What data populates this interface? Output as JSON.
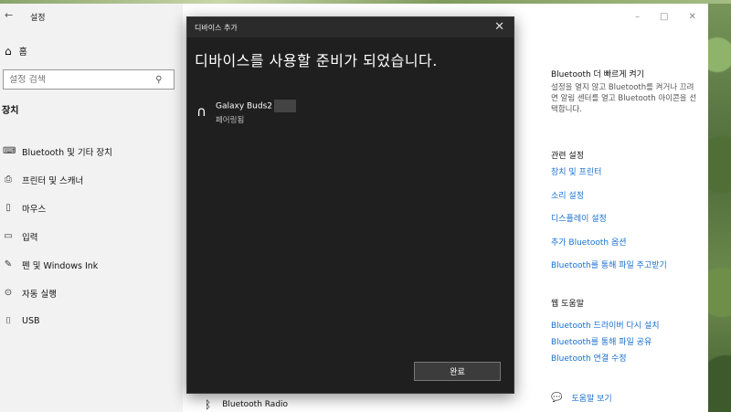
{
  "settings": {
    "title": "설정",
    "back_icon": "back-arrow-icon",
    "home_label": "홈",
    "search_placeholder": "설정 검색",
    "section_title": "장치",
    "nav": [
      {
        "label": "Bluetooth 및 기타 장치",
        "icon": "bluetooth-devices-icon"
      },
      {
        "label": "프린터 및 스캐너",
        "icon": "printer-icon"
      },
      {
        "label": "마우스",
        "icon": "mouse-icon"
      },
      {
        "label": "입력",
        "icon": "keyboard-icon"
      },
      {
        "label": "펜 및 Windows Ink",
        "icon": "pen-icon"
      },
      {
        "label": "자동 실행",
        "icon": "autoplay-icon"
      },
      {
        "label": "USB",
        "icon": "usb-icon"
      }
    ],
    "bluetooth_radio": "Bluetooth Radio"
  },
  "right_panel": {
    "quick_heading": "Bluetooth 더 빠르게 켜기",
    "quick_desc": "설정을 열지 않고 Bluetooth를 켜거나 끄려면 알림 센터를 열고 Bluetooth 아이콘을 선택합니다.",
    "related_heading": "관련 설정",
    "related_links": [
      "장치 및 프린터",
      "소리 설정",
      "디스플레이 설정",
      "추가 Bluetooth 옵션",
      "Bluetooth를 통해 파일 주고받기"
    ],
    "help_heading": "웹 도움말",
    "help_links": [
      "Bluetooth 드라이버 다시 설치",
      "Bluetooth를 통해 파일 공유",
      "Bluetooth 연결 수정"
    ],
    "get_help": "도움말 보기"
  },
  "dialog": {
    "title": "디바이스 추가",
    "heading": "디바이스를 사용할 준비가 되었습니다.",
    "device_name": "Galaxy Buds2",
    "device_status": "페어링됨",
    "device_icon": "headset-icon",
    "done_label": "완료"
  }
}
